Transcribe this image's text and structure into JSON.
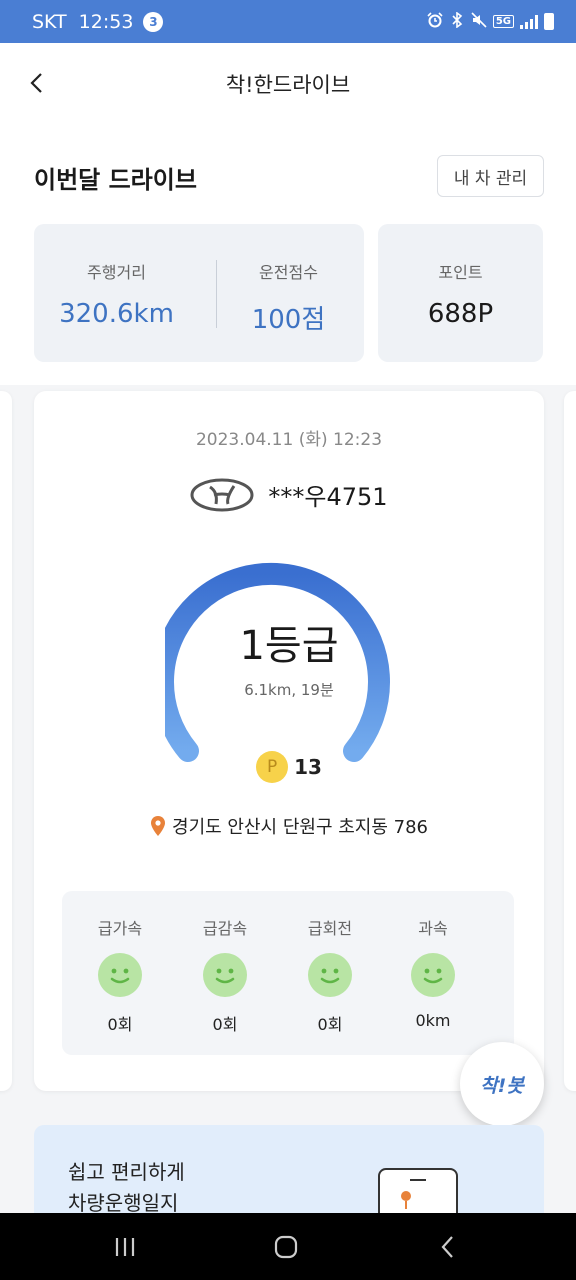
{
  "status_bar": {
    "carrier": "SKT",
    "time": "12:53",
    "notification_count": "3",
    "network_badge": "5G",
    "icons": [
      "alarm-icon",
      "bluetooth-icon",
      "mute-icon",
      "signal-icon",
      "battery-icon"
    ]
  },
  "header": {
    "title": "착!한드라이브",
    "back_icon": "chevron-left-icon"
  },
  "summary": {
    "section_title": "이번달 드라이브",
    "car_button_label": "내 차 관리",
    "distance_label": "주행거리",
    "distance_value": "320.6km",
    "score_label": "운전점수",
    "score_value": "100점",
    "points_label": "포인트",
    "points_value": "688P"
  },
  "trip_card": {
    "datetime": "2023.04.11 (화) 12:23",
    "car_logo_icon": "hyundai-logo-icon",
    "plate": "***우4751",
    "grade": "1등급",
    "trip_info": "6.1km, 19분",
    "earned_points_badge": "P",
    "earned_points": "13",
    "location_icon": "location-pin-icon",
    "location": "경기도 안산시 단원구 초지동 786",
    "events": [
      {
        "name": "급가속",
        "count": "0회",
        "icon": "smile-face-icon"
      },
      {
        "name": "급감속",
        "count": "0회",
        "icon": "smile-face-icon"
      },
      {
        "name": "급회전",
        "count": "0회",
        "icon": "smile-face-icon"
      },
      {
        "name": "과속",
        "count": "0km",
        "icon": "smile-face-icon"
      }
    ]
  },
  "fab": {
    "label": "착!봇"
  },
  "banner": {
    "line1": "쉽고 편리하게",
    "line2": "차량운행일지"
  },
  "nav_bar": {
    "icons": [
      "recent-apps-icon",
      "home-icon",
      "back-icon"
    ]
  },
  "colors": {
    "accent": "#4a7ed3",
    "stat_value": "#3e73c2",
    "gauge_start": "#3a6fd0",
    "gauge_end": "#73abee",
    "face": "#b8e4a4",
    "face_features": "#5fb546",
    "point_coin": "#f7d24a",
    "pin": "#e8823a"
  }
}
